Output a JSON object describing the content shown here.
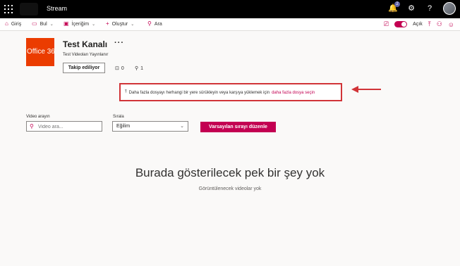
{
  "app": {
    "title": "Stream",
    "notification_count": "2"
  },
  "nav": {
    "home": "Giriş",
    "discover": "Bul",
    "content": "İçeriğim",
    "create": "Oluştur",
    "search": "Ara",
    "toggle_label": "Açık"
  },
  "channel": {
    "logo_text": "Office 365",
    "title": "Test Kanalı",
    "more": "···",
    "subtitle": "Test Videoları Yayınlanır",
    "follow_label": "Takip ediliyor",
    "video_count": "0",
    "follower_count": "1"
  },
  "upload": {
    "text": "Daha fazla dosyayı herhangi bir yere sürükleyin veya karşıya yüklemek için",
    "link": "daha fazla dosya seçin"
  },
  "filters": {
    "search_label": "Video arayın",
    "search_placeholder": "Video ara...",
    "sort_label": "Sırala",
    "sort_value": "Eğilim",
    "reset_button": "Varsayılan sırayı düzenle"
  },
  "empty": {
    "title": "Burada gösterilecek pek bir şey yok",
    "subtitle": "Görüntülenecek videolar yok"
  },
  "colors": {
    "accent": "#c30052",
    "highlight": "#d13438",
    "logo": "#eb3c00"
  }
}
